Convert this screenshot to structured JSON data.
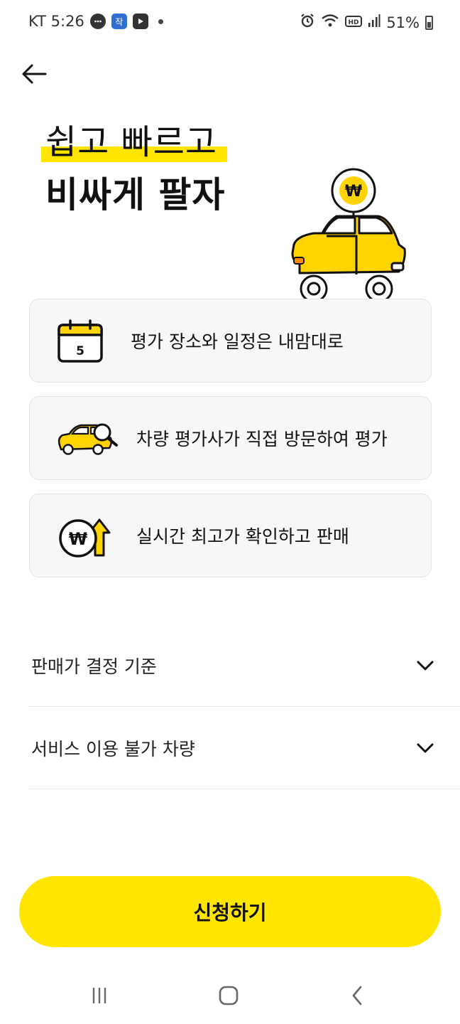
{
  "status_bar": {
    "carrier_time": "KT 5:26",
    "notif_icons": [
      "chat-bubble-icon",
      "app-badge-icon",
      "youtube-icon"
    ],
    "notif_app_badge_text": "작",
    "battery": "51%"
  },
  "hero": {
    "line1": "쉽고 빠르고",
    "line2": "비싸게 팔자",
    "won_symbol": "₩"
  },
  "features": [
    {
      "label": "평가 장소와 일정은 내맘대로",
      "icon": "calendar-icon",
      "calendar_day": "5"
    },
    {
      "label": "차량 평가사가 직접 방문하여 평가",
      "icon": "car-inspection-icon"
    },
    {
      "label": "실시간 최고가 확인하고 판매",
      "icon": "price-up-icon",
      "won_symbol": "₩"
    }
  ],
  "accordion": [
    {
      "label": "판매가 결정 기준"
    },
    {
      "label": "서비스 이용 불가 차량"
    }
  ],
  "cta": {
    "label": "신청하기"
  },
  "colors": {
    "accent": "#ffe500",
    "card_bg": "#f7f7f9",
    "text": "#111111"
  }
}
